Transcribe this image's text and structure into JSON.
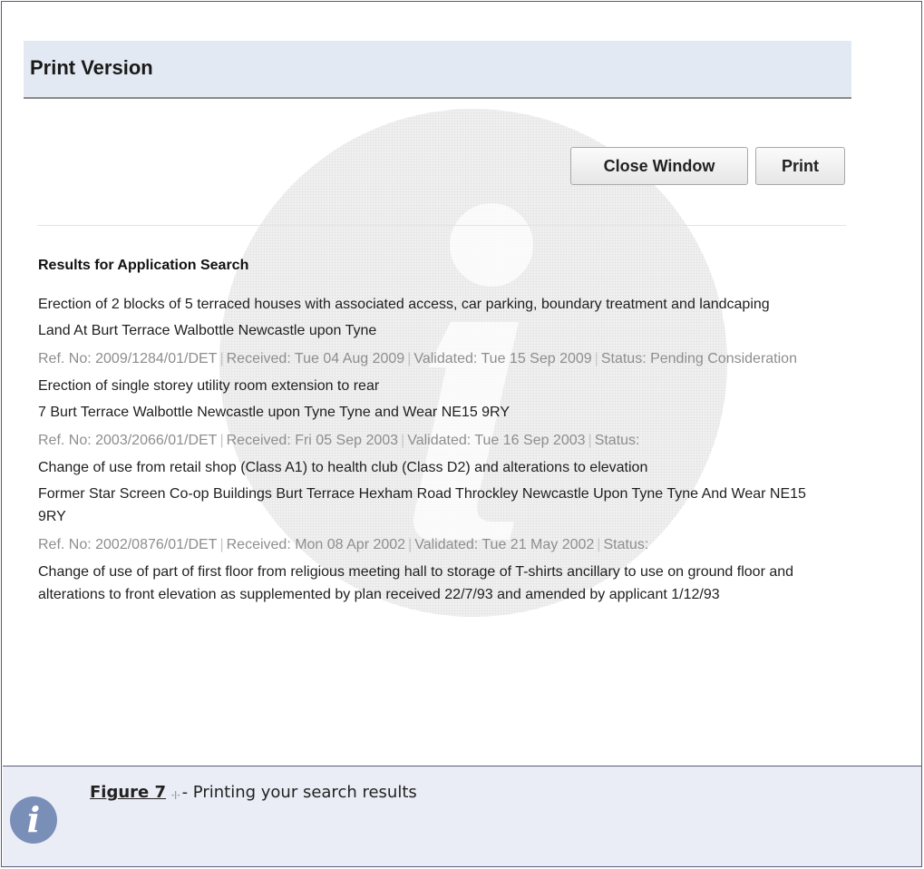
{
  "page": {
    "title": "Print Version"
  },
  "toolbar": {
    "close_label": "Close Window",
    "print_label": "Print"
  },
  "results": {
    "heading": "Results for Application Search",
    "items": [
      {
        "description": "Erection of 2 blocks of 5 terraced houses with associated access, car parking, boundary treatment and landcaping",
        "address": "Land At Burt Terrace Walbottle Newcastle upon Tyne",
        "ref": "Ref. No: 2009/1284/01/DET",
        "received": "Received: Tue 04 Aug 2009",
        "validated": "Validated: Tue 15 Sep 2009",
        "status": "Status: Pending Consideration"
      },
      {
        "description": "Erection of single storey utility room extension to rear",
        "address": "7 Burt Terrace Walbottle Newcastle upon Tyne Tyne and Wear NE15 9RY",
        "ref": "Ref. No: 2003/2066/01/DET",
        "received": "Received: Fri 05 Sep 2003",
        "validated": "Validated: Tue 16 Sep 2003",
        "status": "Status:"
      },
      {
        "description": "Change of use from retail shop (Class A1) to health club (Class D2) and alterations to elevation",
        "address": "Former Star Screen Co-op Buildings Burt Terrace Hexham Road Throckley Newcastle Upon Tyne Tyne And Wear NE15 9RY",
        "ref": "Ref. No: 2002/0876/01/DET",
        "received": "Received: Mon 08 Apr 2002",
        "validated": "Validated: Tue 21 May 2002",
        "status": "Status:"
      },
      {
        "description": "Change of use of part of first floor from religious meeting hall to storage of T-shirts ancillary to use on ground floor and alterations to front elevation as supplemented by plan received 22/7/93 and amended by applicant 1/12/93"
      }
    ]
  },
  "figure": {
    "label": "Figure 7",
    "mark": "-|-",
    "text": "- Printing your search results",
    "icon": "info-icon",
    "accent": "#7a8fb8"
  }
}
